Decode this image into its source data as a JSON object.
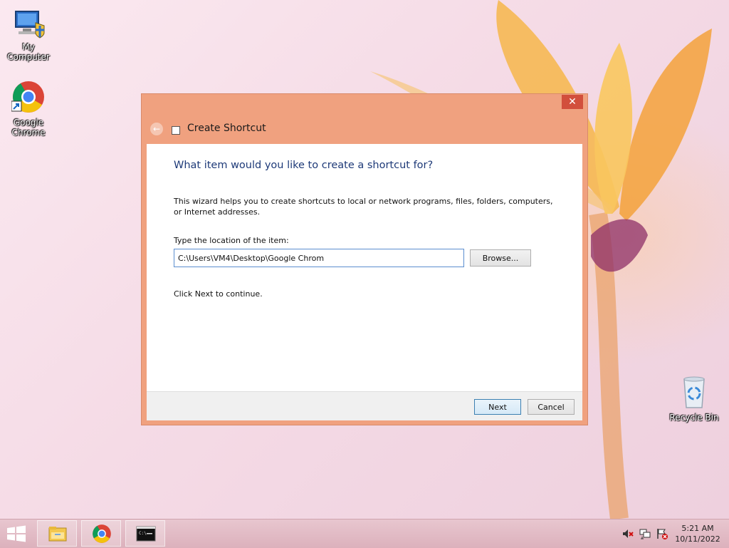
{
  "desktop": {
    "icons": [
      {
        "label": "My Computer",
        "icon": "computer-icon"
      },
      {
        "label": "Google Chrome",
        "icon": "chrome-icon"
      },
      {
        "label": "Recycle Bin",
        "icon": "recycle-bin-icon"
      }
    ]
  },
  "dialog": {
    "title": "Create Shortcut",
    "close_label": "✕",
    "back_label": "←",
    "heading": "What item would you like to create a shortcut for?",
    "description": "This wizard helps you to create shortcuts to local or network programs, files, folders, computers, or Internet addresses.",
    "location_label": "Type the location of the item:",
    "location_value": "C:\\Users\\VM4\\Desktop\\Google Chrom",
    "browse_label": "Browse...",
    "continue_text": "Click Next to continue.",
    "next_label": "Next",
    "cancel_label": "Cancel"
  },
  "taskbar": {
    "pinned": [
      "file-explorer-icon",
      "chrome-icon",
      "command-prompt-icon"
    ],
    "clock_time": "5:21 AM",
    "clock_date": "10/11/2022",
    "tray": [
      "volume-muted-icon",
      "network-icon",
      "action-center-flag-icon"
    ]
  },
  "colors": {
    "dialog_frame": "#f0a17f",
    "heading_text": "#1e3a78",
    "close_button": "#d24f3c",
    "taskbar": "#dcb1bc"
  }
}
